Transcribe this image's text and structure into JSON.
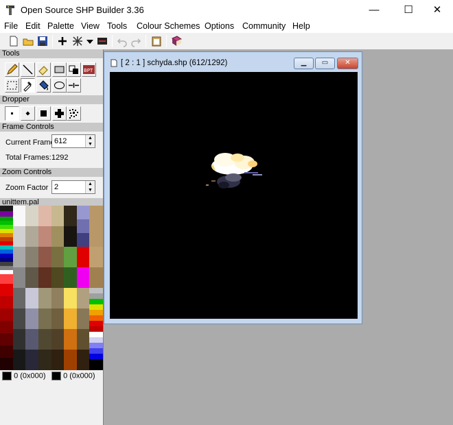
{
  "window": {
    "title": "Open Source SHP Builder 3.36",
    "controls": [
      "—",
      "☐",
      "✕"
    ]
  },
  "menu": [
    "File",
    "Edit",
    "Palette",
    "View",
    "Tools",
    "Colour Schemes",
    "Options",
    "Community",
    "Help"
  ],
  "left_panel": {
    "tools_header": "Tools",
    "dropper_header": "Dropper",
    "frame_controls_header": "Frame Controls",
    "current_frame_label": "Current Frame",
    "current_frame_value": "612",
    "total_frames_label": "Total Frames:",
    "total_frames_value": "1292",
    "zoom_controls_header": "Zoom Controls",
    "zoom_factor_label": "Zoom Factor",
    "zoom_factor_value": "2",
    "palette_name": "unittem.pal",
    "left_swatch_label": "0 (0x000)",
    "right_swatch_label": "0 (0x000)"
  },
  "child_window": {
    "title": "[ 2 : 1 ] schyda.shp (612/1292)"
  },
  "colors": {
    "canvas_bg": "#000000",
    "mdi_bg": "#ababab",
    "child_frame": "#c4d7ee"
  }
}
